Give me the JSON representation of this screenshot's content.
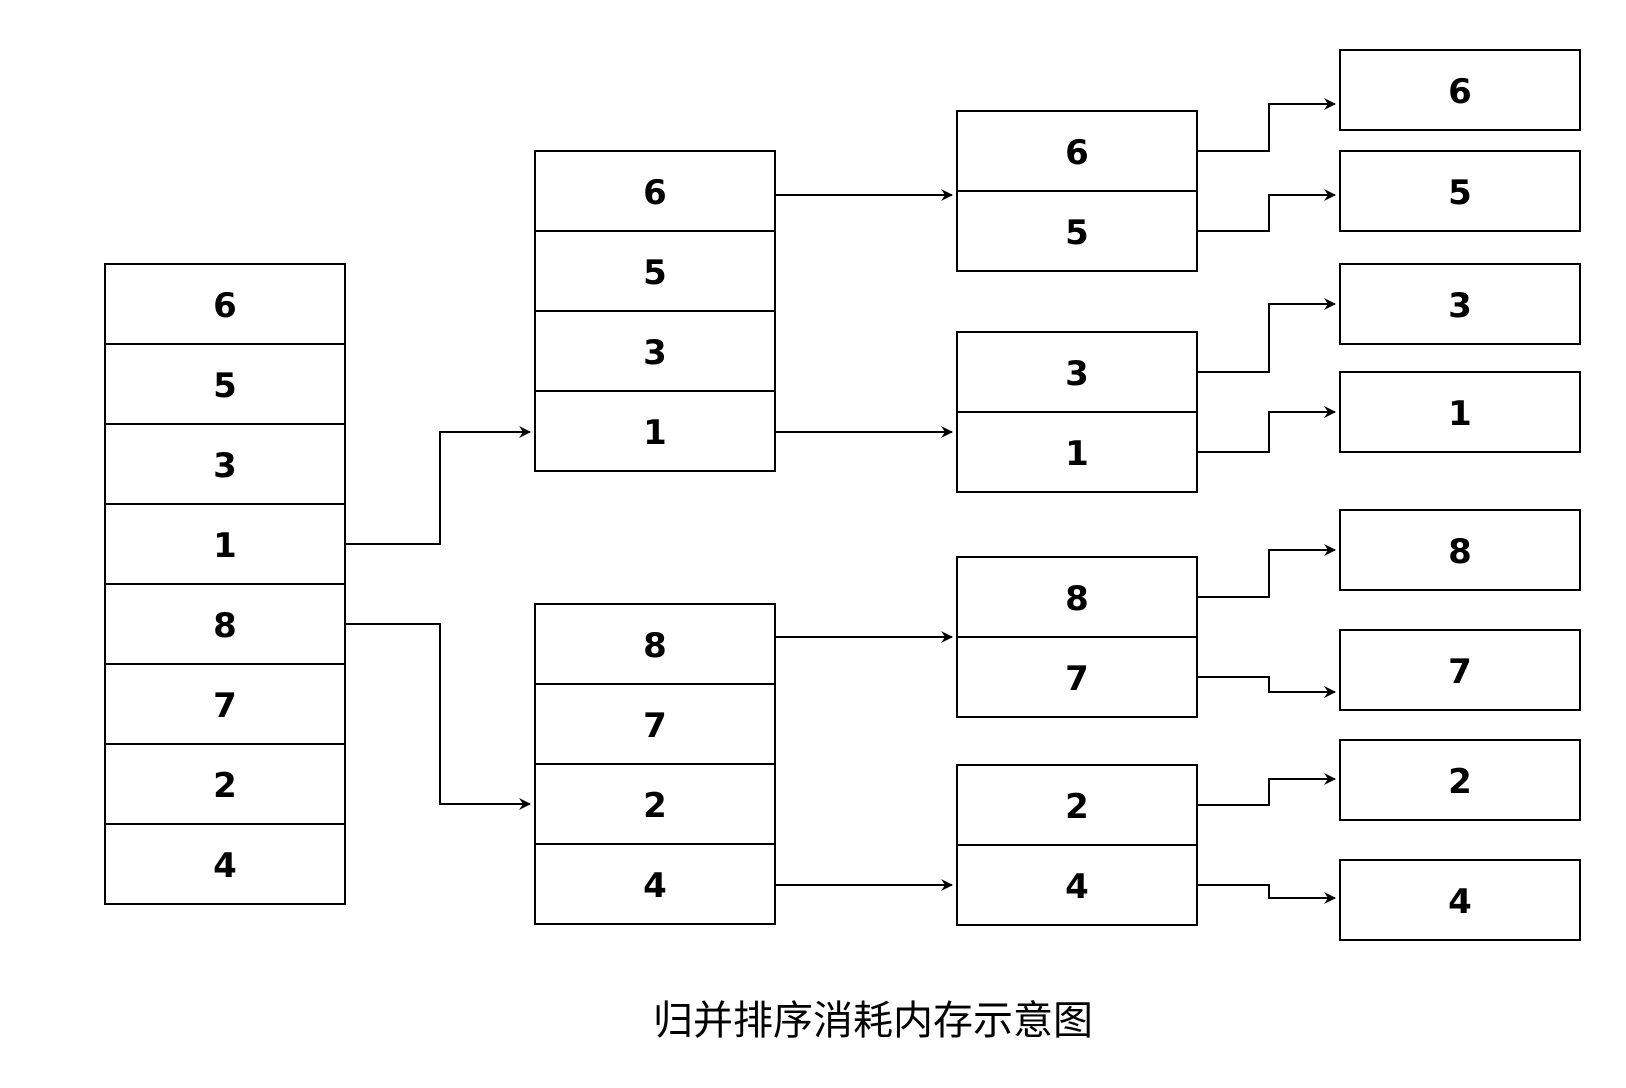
{
  "diagram": {
    "caption": "归并排序消耗内存示意图",
    "level0": {
      "items": [
        "6",
        "5",
        "3",
        "1",
        "8",
        "7",
        "2",
        "4"
      ]
    },
    "level1": {
      "groups": [
        {
          "items": [
            "6",
            "5",
            "3",
            "1"
          ]
        },
        {
          "items": [
            "8",
            "7",
            "2",
            "4"
          ]
        }
      ]
    },
    "level2": {
      "groups": [
        {
          "items": [
            "6",
            "5"
          ]
        },
        {
          "items": [
            "3",
            "1"
          ]
        },
        {
          "items": [
            "8",
            "7"
          ]
        },
        {
          "items": [
            "2",
            "4"
          ]
        }
      ]
    },
    "level3": {
      "items": [
        "6",
        "5",
        "3",
        "1",
        "8",
        "7",
        "2",
        "4"
      ]
    },
    "colors": {
      "stroke": "#000000",
      "fill": "#ffffff",
      "text": "#000000"
    }
  }
}
